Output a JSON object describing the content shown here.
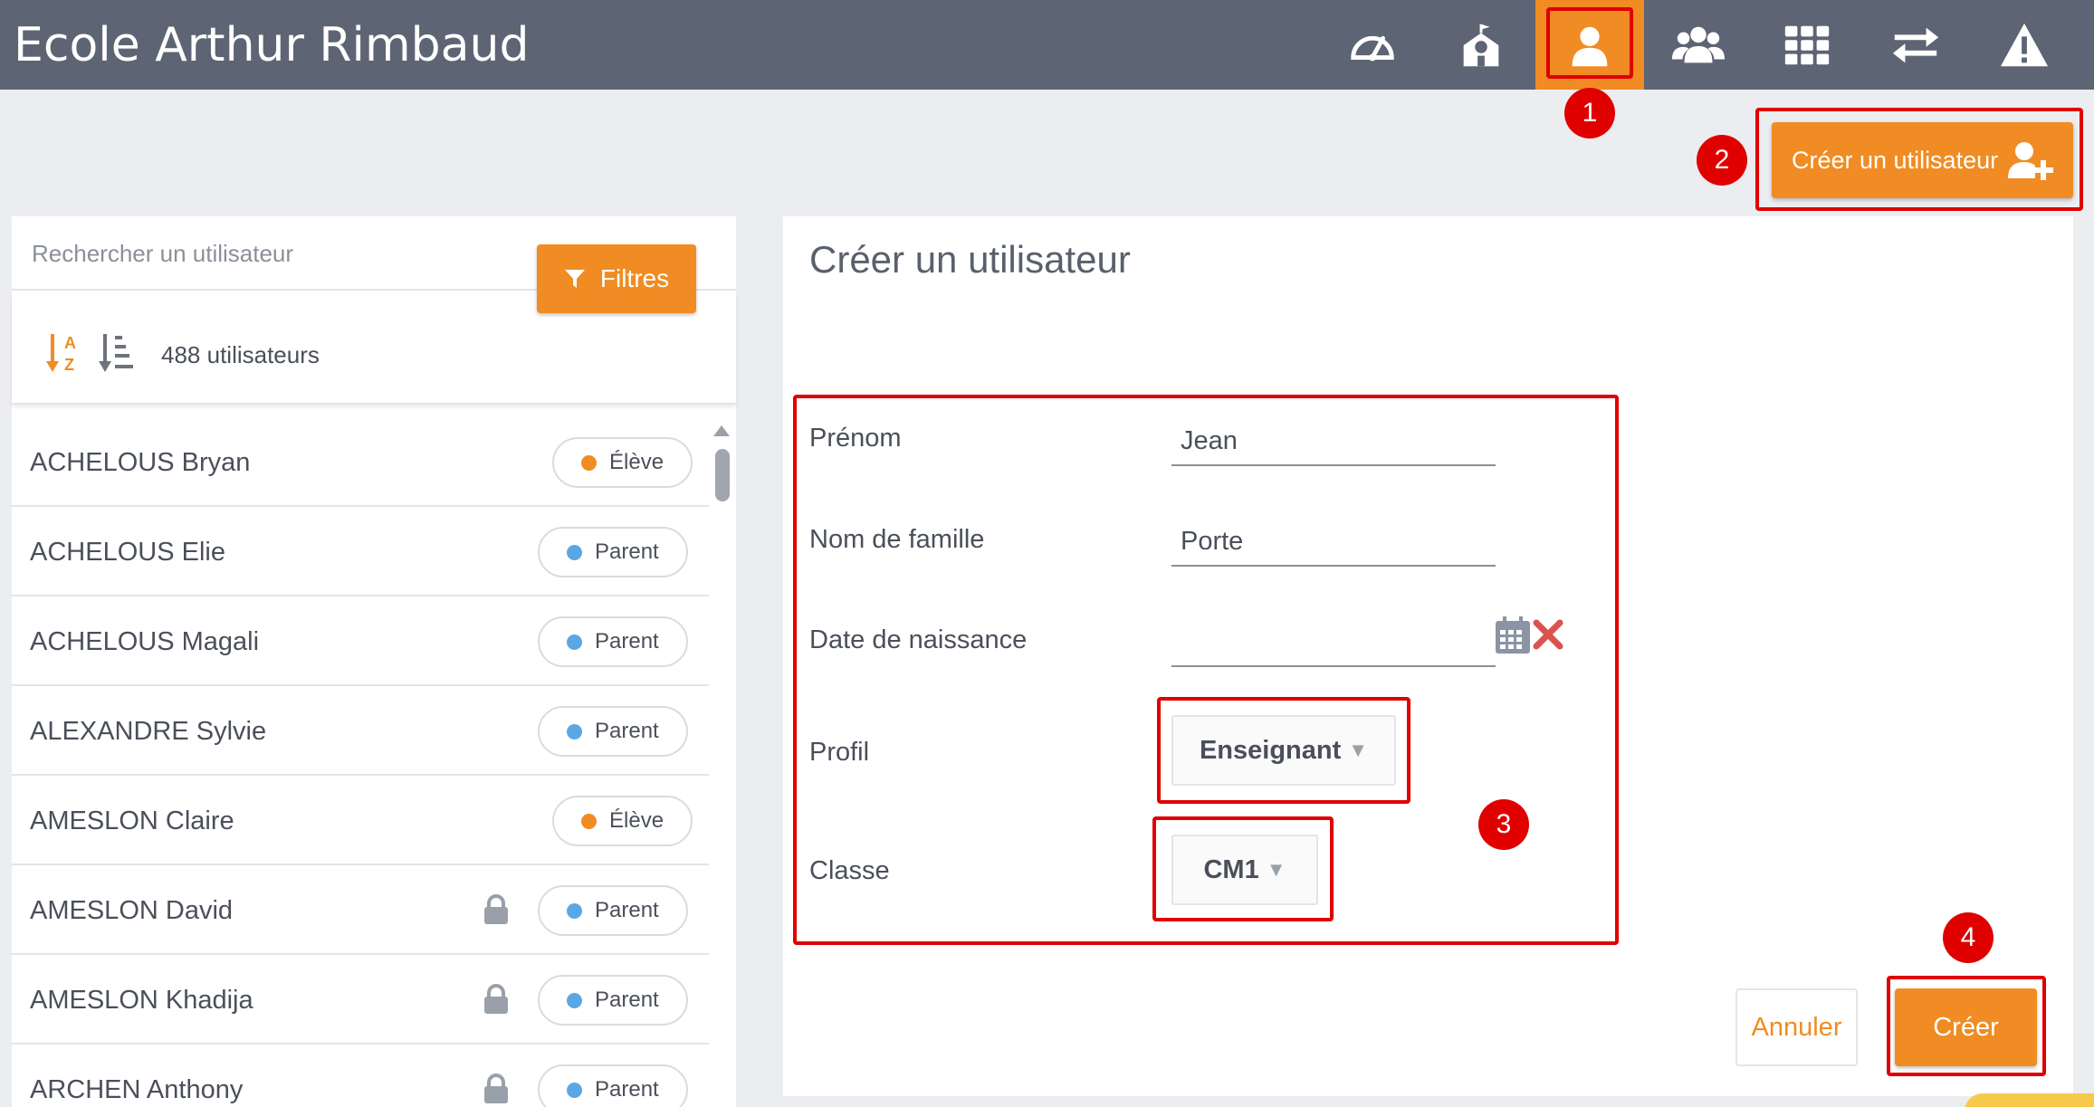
{
  "header": {
    "school_name": "Ecole Arthur Rimbaud",
    "nav": [
      {
        "icon": "dashboard-gauge-icon",
        "active": false
      },
      {
        "icon": "school-building-icon",
        "active": false
      },
      {
        "icon": "user-icon",
        "active": true
      },
      {
        "icon": "users-group-icon",
        "active": false
      },
      {
        "icon": "grid-apps-icon",
        "active": false
      },
      {
        "icon": "exchange-arrows-icon",
        "active": false
      },
      {
        "icon": "warning-icon",
        "active": false
      }
    ]
  },
  "actions": {
    "create_user_label": "Créer un utilisateur"
  },
  "left_panel": {
    "search_placeholder": "Rechercher un utilisateur",
    "user_count": "488 utilisateurs",
    "filters_label": "Filtres",
    "users": [
      {
        "name": "ACHELOUS Bryan",
        "role": "Élève",
        "locked": false
      },
      {
        "name": "ACHELOUS Elie",
        "role": "Parent",
        "locked": false
      },
      {
        "name": "ACHELOUS Magali",
        "role": "Parent",
        "locked": false
      },
      {
        "name": "ALEXANDRE Sylvie",
        "role": "Parent",
        "locked": false
      },
      {
        "name": "AMESLON Claire",
        "role": "Élève",
        "locked": false
      },
      {
        "name": "AMESLON David",
        "role": "Parent",
        "locked": true
      },
      {
        "name": "AMESLON Khadija",
        "role": "Parent",
        "locked": true
      },
      {
        "name": "ARCHEN Anthony",
        "role": "Parent",
        "locked": true
      }
    ]
  },
  "form": {
    "title": "Créer un utilisateur",
    "first_name_label": "Prénom",
    "first_name_value": "Jean",
    "last_name_label": "Nom de famille",
    "last_name_value": "Porte",
    "birthdate_label": "Date de naissance",
    "birthdate_value": "",
    "profile_label": "Profil",
    "profile_value": "Enseignant",
    "class_label": "Classe",
    "class_value": "CM1",
    "cancel_label": "Annuler",
    "create_label": "Créer"
  },
  "annotations": {
    "step1": "1",
    "step2": "2",
    "step3": "3",
    "step4": "4"
  },
  "colors": {
    "accent": "#f08c23",
    "header_bg": "#5d6473",
    "student_dot": "#f08c23",
    "parent_dot": "#5aa7e6",
    "annotation_red": "#e00000"
  }
}
